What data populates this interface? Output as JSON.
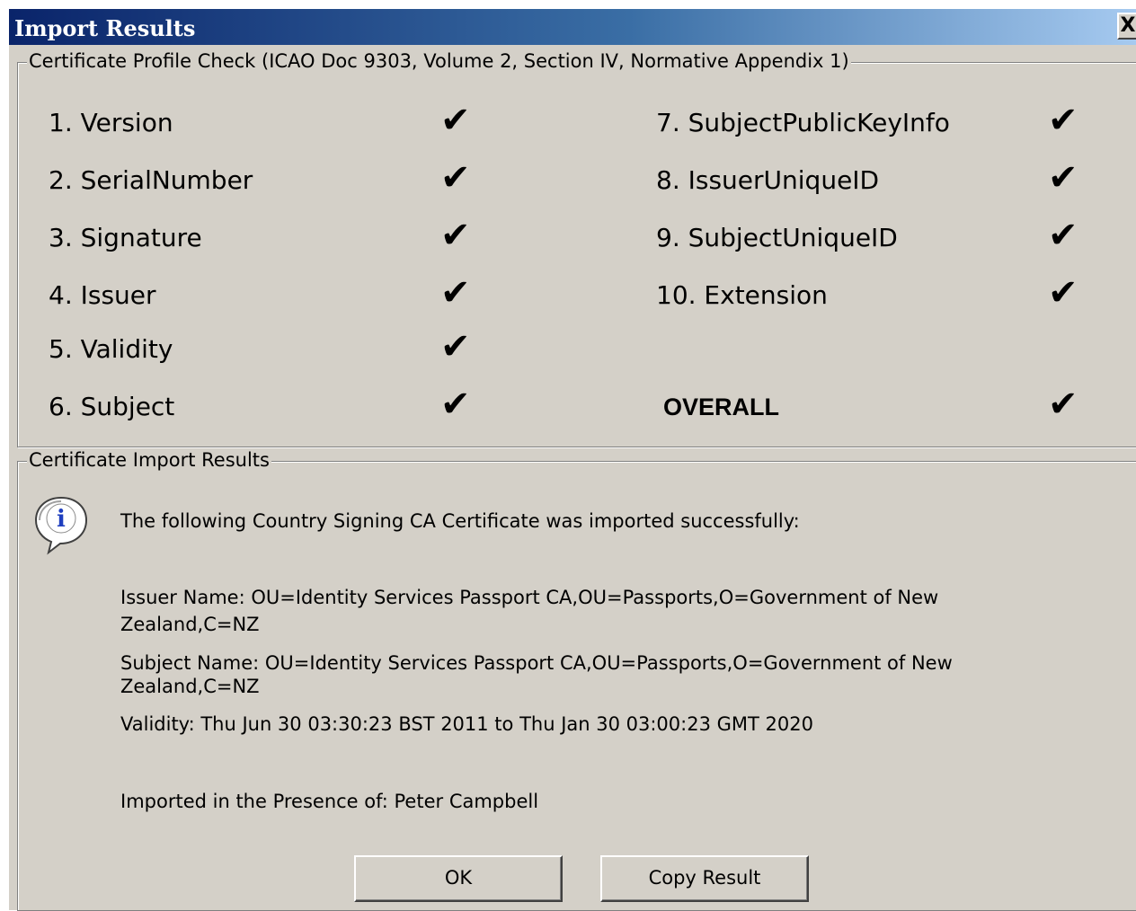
{
  "window": {
    "title": "Import Results",
    "close_label": "X"
  },
  "profile_check": {
    "legend": "Certificate Profile Check (ICAO Doc 9303, Volume 2, Section IV, Normative Appendix 1)",
    "check_glyph": "✔",
    "left_items": [
      {
        "label": "1. Version",
        "passed": true
      },
      {
        "label": "2. SerialNumber",
        "passed": true
      },
      {
        "label": "3. Signature",
        "passed": true
      },
      {
        "label": "4. Issuer",
        "passed": true
      },
      {
        "label": "5. Validity",
        "passed": true
      },
      {
        "label": "6. Subject",
        "passed": true
      }
    ],
    "right_items": [
      {
        "label": "7. SubjectPublicKeyInfo",
        "passed": true
      },
      {
        "label": "8. IssuerUniqueID",
        "passed": true
      },
      {
        "label": "9. SubjectUniqueID",
        "passed": true
      },
      {
        "label": "10. Extension",
        "passed": true
      }
    ],
    "overall": {
      "label": "OVERALL",
      "passed": true
    }
  },
  "import_results": {
    "legend": "Certificate Import Results",
    "icon": "info-icon",
    "headline": "The following Country Signing CA Certificate was imported successfully:",
    "issuer_line1": "Issuer Name: OU=Identity Services Passport CA,OU=Passports,O=Government of New",
    "issuer_line2": "Zealand,C=NZ",
    "subject_line1": "Subject Name: OU=Identity Services Passport CA,OU=Passports,O=Government of New",
    "subject_line2": "Zealand,C=NZ",
    "validity": "Validity: Thu Jun 30 03:30:23 BST 2011 to Thu Jan 30 03:00:23 GMT 2020",
    "presence": "Imported in the Presence of: Peter Campbell"
  },
  "buttons": {
    "ok_label": "OK",
    "copy_label": "Copy Result"
  },
  "colors": {
    "dialog_face": "#d4d0c8",
    "titlebar_start": "#0a246a",
    "titlebar_end": "#a6caf0"
  }
}
